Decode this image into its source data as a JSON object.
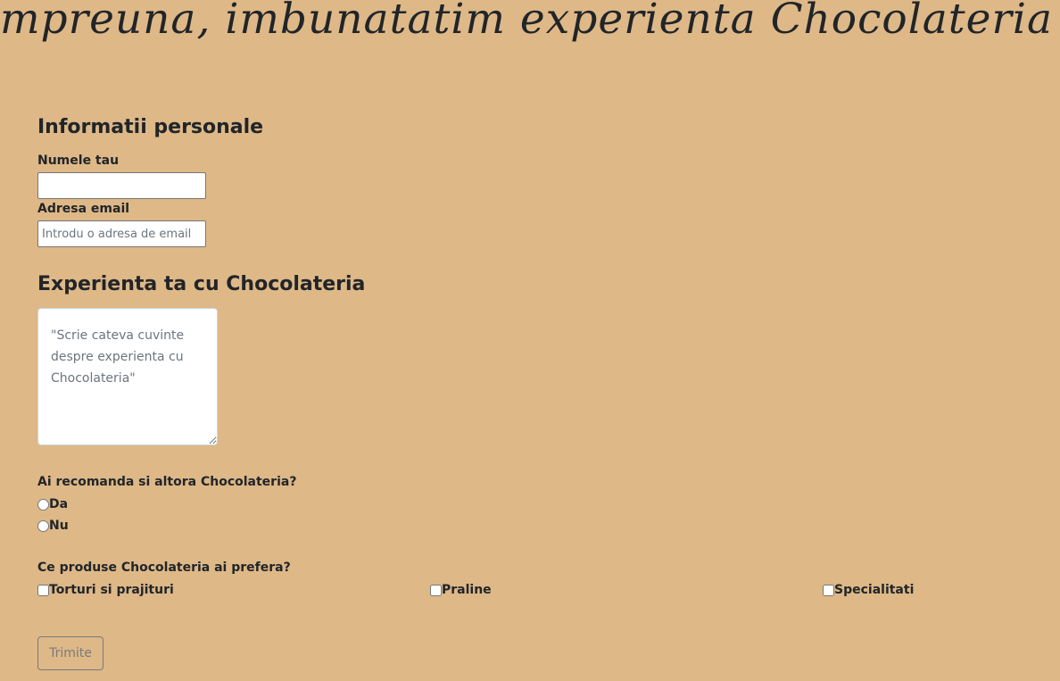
{
  "header": {
    "title": "Impreuna, imbunatatim experienta Chocolateria"
  },
  "personal_section": {
    "title": "Informatii personale",
    "name_label": "Numele tau",
    "name_value": "",
    "email_label": "Adresa email",
    "email_value": "",
    "email_placeholder": "Introdu o adresa de email"
  },
  "experience_section": {
    "title": "Experienta ta cu Chocolateria",
    "textarea_value": "",
    "textarea_placeholder": "\"Scrie cateva cuvinte despre experienta cu Chocolateria\""
  },
  "recommend": {
    "question": "Ai recomanda si altora Chocolateria?",
    "options": [
      "Da",
      "Nu"
    ],
    "selected": null
  },
  "products": {
    "question": "Ce produse Chocolateria ai prefera?",
    "options": [
      "Torturi si prajituri",
      "Praline",
      "Specialitati"
    ],
    "checked": [
      false,
      false,
      false
    ]
  },
  "submit_label": "Trimite",
  "colors": {
    "background": "#deb887",
    "text": "#212529",
    "muted": "#6c757d"
  }
}
